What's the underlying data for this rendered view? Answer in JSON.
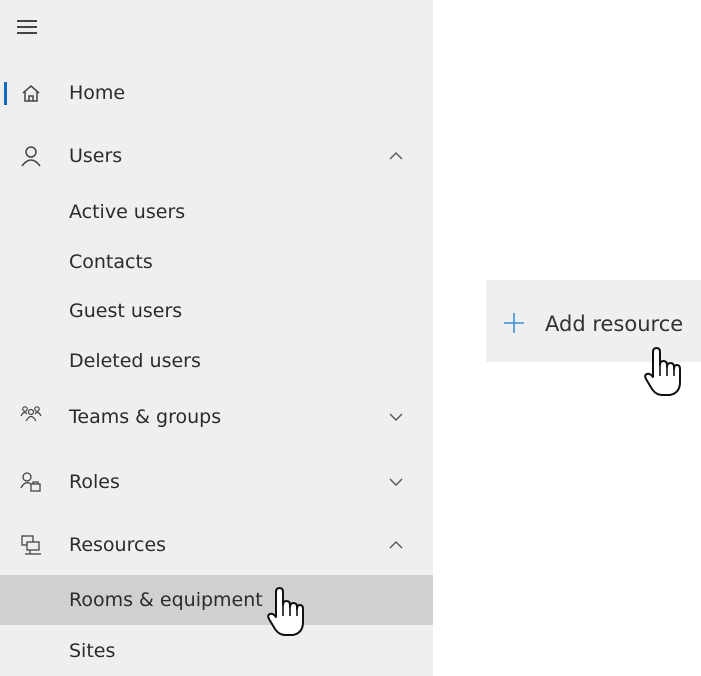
{
  "colors": {
    "sidebar_bg": "#efefef",
    "highlight_bg": "#d0d0d0",
    "accent": "#0f6cbd",
    "plus_icon": "#3b8fd6"
  },
  "sidebar": {
    "menu_icon": "hamburger-icon",
    "items": [
      {
        "label": "Home",
        "icon": "home-icon",
        "selected": true
      },
      {
        "label": "Users",
        "icon": "person-icon",
        "chevron": "up",
        "children": [
          {
            "label": "Active users"
          },
          {
            "label": "Contacts"
          },
          {
            "label": "Guest users"
          },
          {
            "label": "Deleted users"
          }
        ]
      },
      {
        "label": "Teams & groups",
        "icon": "teams-icon",
        "chevron": "down"
      },
      {
        "label": "Roles",
        "icon": "roles-icon",
        "chevron": "down"
      },
      {
        "label": "Resources",
        "icon": "resources-icon",
        "chevron": "up",
        "children": [
          {
            "label": "Rooms & equipment",
            "highlighted": true
          },
          {
            "label": "Sites"
          }
        ]
      }
    ]
  },
  "action": {
    "label": "Add resource",
    "icon": "plus-icon"
  },
  "cursors": [
    "hand-pointer-cursor",
    "hand-pointer-cursor"
  ]
}
